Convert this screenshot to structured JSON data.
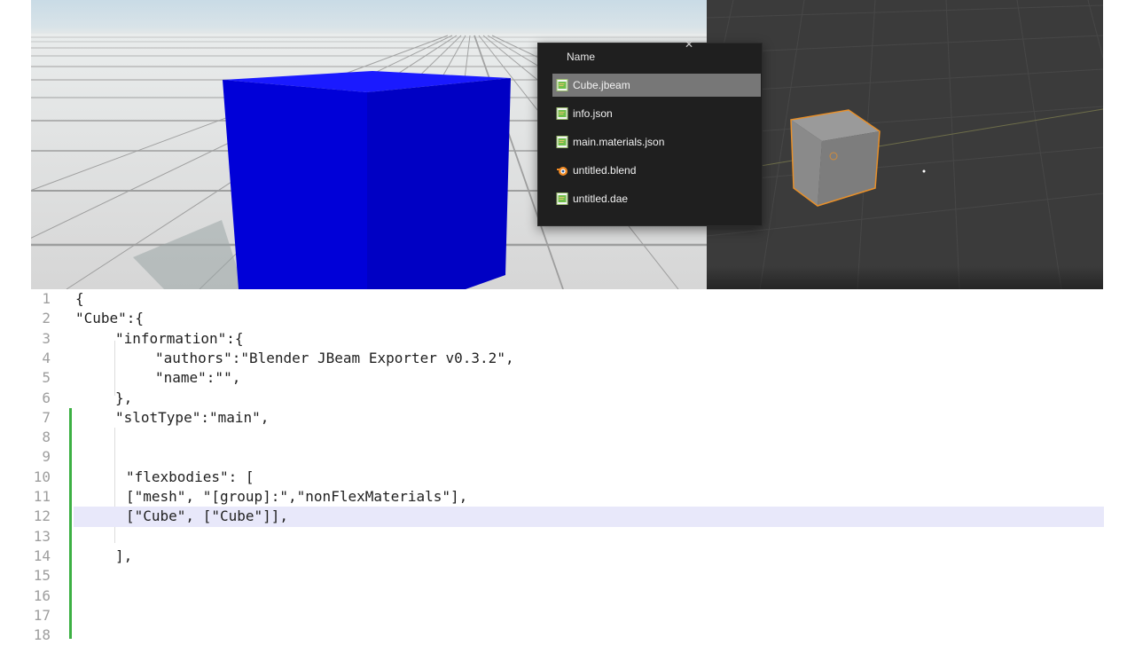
{
  "file_popup": {
    "header": "Name",
    "close_icon": "close-icon",
    "files": [
      {
        "name": "Cube.jbeam",
        "icon": "text-file-icon",
        "selected": true
      },
      {
        "name": "info.json",
        "icon": "text-file-icon",
        "selected": false
      },
      {
        "name": "main.materials.json",
        "icon": "text-file-icon",
        "selected": false
      },
      {
        "name": "untitled.blend",
        "icon": "blender-file-icon",
        "selected": false
      },
      {
        "name": "untitled.dae",
        "icon": "text-file-icon",
        "selected": false
      }
    ]
  },
  "editor": {
    "lines": [
      {
        "num": "1",
        "text": "{"
      },
      {
        "num": "2",
        "text": "\"Cube\":{"
      },
      {
        "num": "3",
        "text": "\"information\":{"
      },
      {
        "num": "4",
        "text": "\"authors\":\"Blender JBeam Exporter v0.3.2\","
      },
      {
        "num": "5",
        "text": "\"name\":\"\","
      },
      {
        "num": "6",
        "text": "},"
      },
      {
        "num": "7",
        "text": "\"slotType\":\"main\","
      },
      {
        "num": "8",
        "text": ""
      },
      {
        "num": "9",
        "text": ""
      },
      {
        "num": "10",
        "text": "\"flexbodies\": ["
      },
      {
        "num": "11",
        "text": "[\"mesh\", \"[group]:\",\"nonFlexMaterials\"],"
      },
      {
        "num": "12",
        "text": "[\"Cube\", [\"Cube\"]],"
      },
      {
        "num": "13",
        "text": ""
      },
      {
        "num": "14",
        "text": "],"
      },
      {
        "num": "15",
        "text": ""
      },
      {
        "num": "16",
        "text": ""
      },
      {
        "num": "17",
        "text": ""
      },
      {
        "num": "18",
        "text": ""
      }
    ]
  },
  "colors": {
    "beamng_cube": "#0000d8",
    "blender_background": "#3b3b3b",
    "selection_outline": "#e8902a",
    "change_bar": "#3cb043",
    "line_highlight": "#e8e8fa"
  }
}
